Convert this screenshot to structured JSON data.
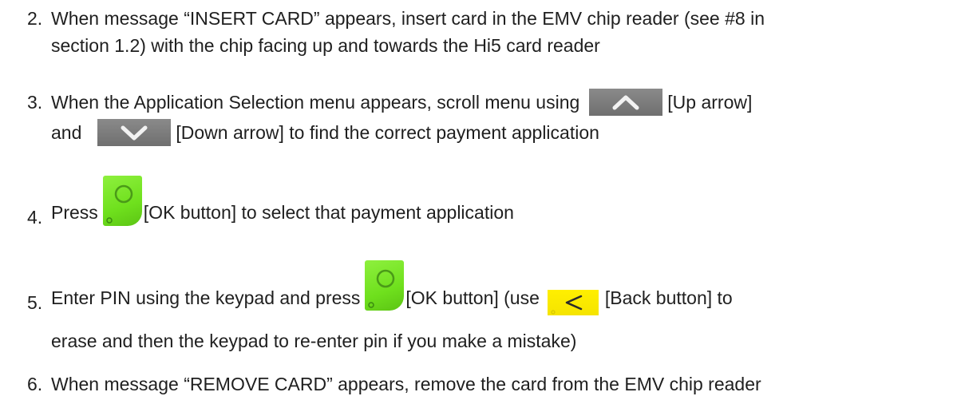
{
  "steps": [
    {
      "number": "2.",
      "line1": "When message “INSERT CARD” appears, insert card in the EMV chip reader (see #8 in",
      "line2": "section 1.2)  with the chip facing up and towards the Hi5 card reader"
    },
    {
      "number": "3.",
      "line1_a": "When the Application Selection menu appears, scroll menu using",
      "line1_b": "[Up arrow]",
      "line2_a": "and",
      "line2_b": "[Down arrow] to find the correct payment application"
    },
    {
      "number": "4.",
      "line1_a": "Press",
      "line1_b": "[OK button] to select that payment application"
    },
    {
      "number": "5.",
      "line1_a": "Enter PIN using the keypad and press",
      "line1_b": "[OK button] (use",
      "line1_c": "[Back button] to",
      "line2": "erase and then the keypad to re-enter pin if you make a mistake)"
    },
    {
      "number": "6.",
      "line1": "When message “REMOVE CARD” appears, remove the card from the EMV chip reader"
    }
  ],
  "icons": {
    "up_arrow": "up-arrow-icon",
    "down_arrow": "down-arrow-icon",
    "ok_button": "ok-button-icon",
    "back_button": "back-button-icon"
  },
  "colors": {
    "text": "#1f1f1f",
    "keypad_grey": "#777777",
    "ok_green": "#6fe01d",
    "back_yellow": "#ffef00"
  }
}
